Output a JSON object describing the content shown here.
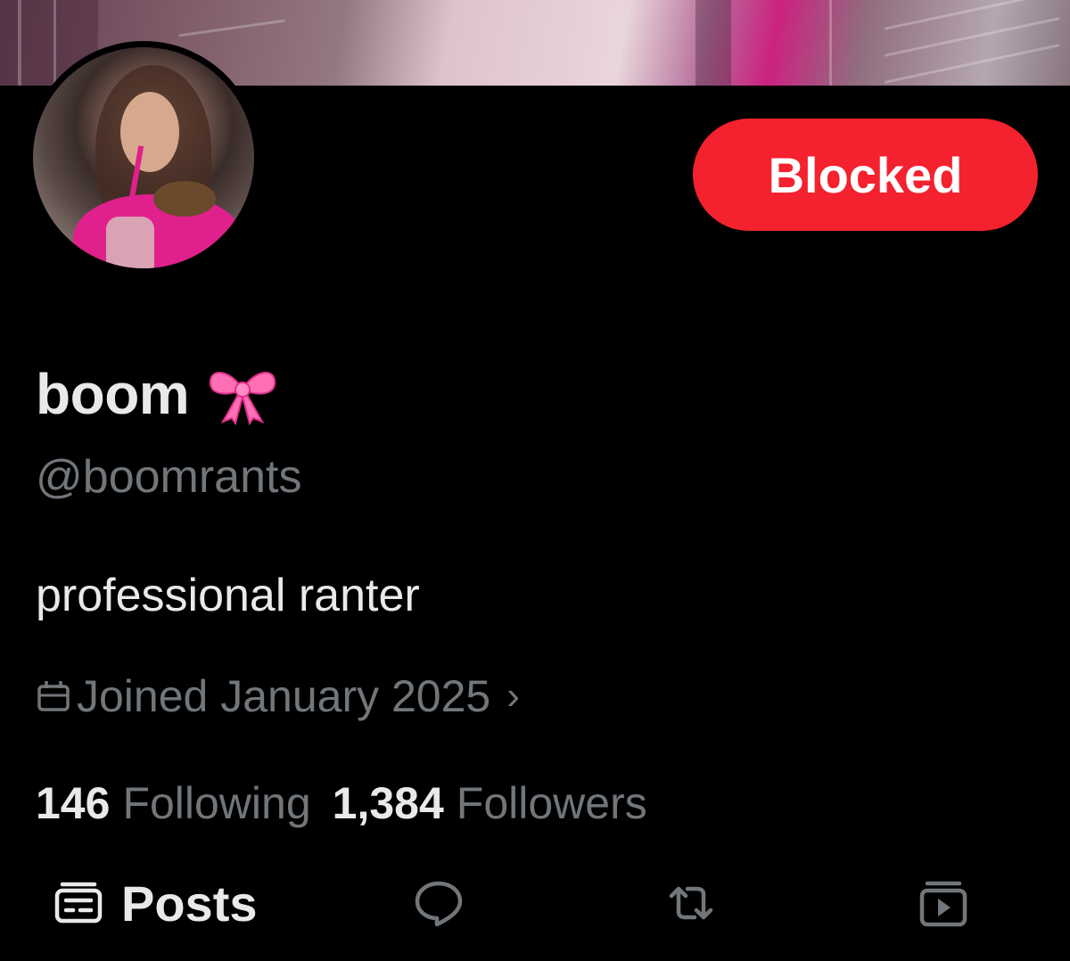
{
  "profile": {
    "display_name": "boom",
    "name_emoji": "bow-icon",
    "handle": "@boomrants",
    "bio": "professional ranter",
    "joined": "Joined January 2025",
    "action_button": "Blocked",
    "stats": {
      "following_count": "146",
      "following_label": "Following",
      "followers_count": "1,384",
      "followers_label": "Followers"
    }
  },
  "tabs": {
    "posts_label": "Posts",
    "icons": [
      "posts-icon",
      "replies-icon",
      "reposts-icon",
      "media-icon"
    ]
  },
  "colors": {
    "background": "#000000",
    "primary_text": "#e7e9ea",
    "secondary_text": "#71767b",
    "blocked_button": "#f4212e"
  }
}
